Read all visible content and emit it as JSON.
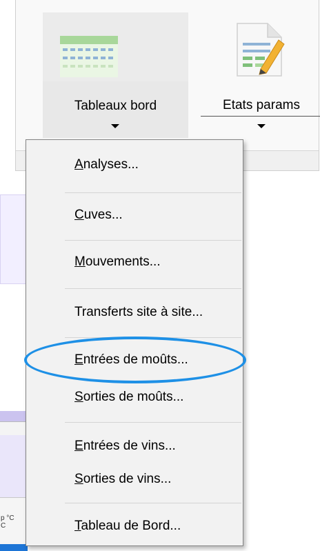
{
  "ribbon": {
    "tableaux_bord": {
      "label": "Tableaux bord"
    },
    "etats_params": {
      "label": "Etats params"
    }
  },
  "menu": {
    "items": [
      {
        "mnemonic": "A",
        "rest": "nalyses..."
      },
      {
        "mnemonic": "C",
        "rest": "uves..."
      },
      {
        "mnemonic": "M",
        "rest": "ouvements..."
      },
      {
        "mnemonic": "",
        "rest": "Transferts site à site..."
      },
      {
        "mnemonic": "E",
        "rest": "ntrées de moûts..."
      },
      {
        "mnemonic": "S",
        "rest": "orties de moûts..."
      },
      {
        "mnemonic": "E",
        "rest": "ntrées de vins..."
      },
      {
        "mnemonic": "S",
        "rest": "orties de vins..."
      },
      {
        "mnemonic": "T",
        "rest": "ableau de Bord..."
      }
    ]
  },
  "background": {
    "column_header_line1": "p °C",
    "column_header_line2": "C"
  },
  "colors": {
    "highlight": "#1e90e6",
    "menu_bg": "#f2f2f2",
    "ribbon_bg": "#f9f9f9",
    "taskbar_blue": "#1e75d6"
  }
}
